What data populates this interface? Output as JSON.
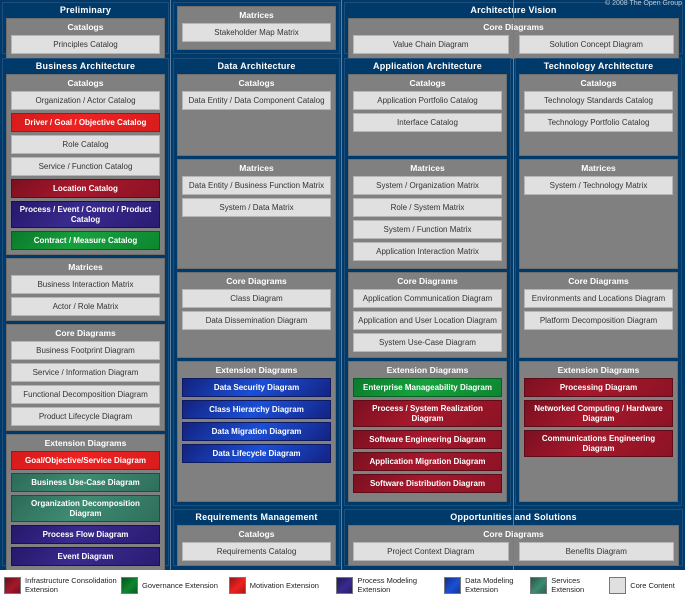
{
  "copyright": "© 2008 The Open Group",
  "group_labels": {
    "catalogs": "Catalogs",
    "matrices": "Matrices",
    "core_diagrams": "Core Diagrams",
    "extension_diagrams": "Extension Diagrams"
  },
  "phases": {
    "preliminary": {
      "title": "Preliminary",
      "catalogs": [
        "Principles Catalog"
      ]
    },
    "architecture_vision": {
      "title": "Architecture Vision",
      "core_diagrams": [
        "Value Chain Diagram",
        "Solution Concept Diagram"
      ]
    },
    "stakeholder": {
      "matrices": [
        "Stakeholder Map Matrix"
      ]
    },
    "business_architecture": {
      "title": "Business Architecture",
      "catalogs": [
        {
          "label": "Organization / Actor Catalog",
          "style": "core"
        },
        {
          "label": "Driver / Goal / Objective Catalog",
          "style": "motiv"
        },
        {
          "label": "Role Catalog",
          "style": "core"
        },
        {
          "label": "Service / Function Catalog",
          "style": "core"
        },
        {
          "label": "Location Catalog",
          "style": "infra"
        },
        {
          "label": "Process / Event / Control / Product Catalog",
          "style": "procmod"
        },
        {
          "label": "Contract / Measure Catalog",
          "style": "gov"
        }
      ],
      "matrices": [
        {
          "label": "Business Interaction Matrix",
          "style": "core"
        },
        {
          "label": "Actor / Role Matrix",
          "style": "core"
        }
      ],
      "core_diagrams": [
        {
          "label": "Business Footprint Diagram",
          "style": "core"
        },
        {
          "label": "Service / Information Diagram",
          "style": "core"
        },
        {
          "label": "Functional Decomposition Diagram",
          "style": "core"
        },
        {
          "label": "Product Lifecycle Diagram",
          "style": "core"
        }
      ],
      "extension_diagrams": [
        {
          "label": "Goal/Objective/Service Diagram",
          "style": "motiv"
        },
        {
          "label": "Business Use-Case Diagram",
          "style": "services"
        },
        {
          "label": "Organization Decomposition Diagram",
          "style": "services"
        },
        {
          "label": "Process Flow Diagram",
          "style": "procmod"
        },
        {
          "label": "Event Diagram",
          "style": "procmod"
        }
      ]
    },
    "data_architecture": {
      "title": "Data Architecture",
      "catalogs": [
        {
          "label": "Data Entity / Data Component Catalog",
          "style": "core"
        }
      ],
      "matrices": [
        {
          "label": "Data Entity / Business Function Matrix",
          "style": "core"
        },
        {
          "label": "System / Data Matrix",
          "style": "core"
        }
      ],
      "core_diagrams": [
        {
          "label": "Class Diagram",
          "style": "core"
        },
        {
          "label": "Data Dissemination Diagram",
          "style": "core"
        }
      ],
      "extension_diagrams": [
        {
          "label": "Data Security Diagram",
          "style": "datamod"
        },
        {
          "label": "Class Hierarchy Diagram",
          "style": "datamod"
        },
        {
          "label": "Data Migration Diagram",
          "style": "datamod"
        },
        {
          "label": "Data Lifecycle Diagram",
          "style": "datamod"
        }
      ]
    },
    "application_architecture": {
      "title": "Application Architecture",
      "catalogs": [
        {
          "label": "Application Portfolio Catalog",
          "style": "core"
        },
        {
          "label": "Interface Catalog",
          "style": "core"
        }
      ],
      "matrices": [
        {
          "label": "System / Organization Matrix",
          "style": "core"
        },
        {
          "label": "Role / System Matrix",
          "style": "core"
        },
        {
          "label": "System / Function Matrix",
          "style": "core"
        },
        {
          "label": "Application Interaction Matrix",
          "style": "core"
        }
      ],
      "core_diagrams": [
        {
          "label": "Application Communication Diagram",
          "style": "core"
        },
        {
          "label": "Application and User Location Diagram",
          "style": "core"
        },
        {
          "label": "System Use-Case Diagram",
          "style": "core"
        }
      ],
      "extension_diagrams": [
        {
          "label": "Enterprise Manageability Diagram",
          "style": "gov"
        },
        {
          "label": "Process / System Realization Diagram",
          "style": "infra"
        },
        {
          "label": "Software Engineering Diagram",
          "style": "infra"
        },
        {
          "label": "Application Migration Diagram",
          "style": "infra"
        },
        {
          "label": "Software Distribution Diagram",
          "style": "infra"
        }
      ]
    },
    "technology_architecture": {
      "title": "Technology Architecture",
      "catalogs": [
        {
          "label": "Technology Standards Catalog",
          "style": "core"
        },
        {
          "label": "Technology Portfolio Catalog",
          "style": "core"
        }
      ],
      "matrices": [
        {
          "label": "System / Technology Matrix",
          "style": "core"
        }
      ],
      "core_diagrams": [
        {
          "label": "Environments and Locations Diagram",
          "style": "core"
        },
        {
          "label": "Platform Decomposition Diagram",
          "style": "core"
        }
      ],
      "extension_diagrams": [
        {
          "label": "Processing Diagram",
          "style": "infra"
        },
        {
          "label": "Networked Computing / Hardware Diagram",
          "style": "infra"
        },
        {
          "label": "Communications Engineering Diagram",
          "style": "infra"
        }
      ]
    },
    "requirements_management": {
      "title": "Requirements Management",
      "catalogs": [
        "Requirements Catalog"
      ]
    },
    "opportunities_and_solutions": {
      "title": "Opportunities and Solutions",
      "core_diagrams": [
        "Project Context Diagram",
        "Benefits Diagram"
      ]
    }
  },
  "legend": [
    {
      "label": "Infrastructure Consolidation Extension",
      "color": "#A6182C",
      "style": "infra"
    },
    {
      "label": "Governance Extension",
      "color": "#0E8630",
      "style": "gov"
    },
    {
      "label": "Motivation Extension",
      "color": "#EE2222",
      "style": "motiv"
    },
    {
      "label": "Process Modeling Extension",
      "color": "#392A8E",
      "style": "procmod"
    },
    {
      "label": "Data Modeling Extension",
      "color": "#1B4FD6",
      "style": "datamod"
    },
    {
      "label": "Services Extension",
      "color": "#3E8B72",
      "style": "services"
    },
    {
      "label": "Core Content",
      "color": "#E0E0E0",
      "style": "core"
    }
  ]
}
